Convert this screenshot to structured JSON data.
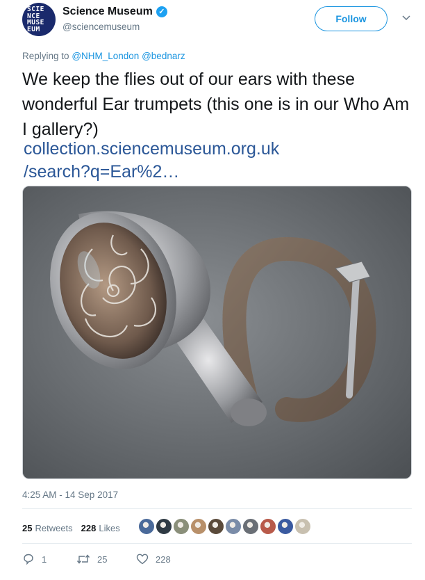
{
  "account": {
    "display_name": "Science Museum",
    "handle": "@sciencemuseum",
    "avatar_logo_lines": [
      "SCIE",
      "NCE",
      "MUSE",
      "EUM"
    ],
    "verified_icon": "verified-badge-icon",
    "verified_glyph": "✓"
  },
  "follow_button": {
    "label": "Follow"
  },
  "menu_caret": {
    "glyph": "⌄",
    "icon": "chevron-down-icon"
  },
  "reply": {
    "prefix": "Replying to",
    "mentions": [
      "@NHM_London",
      "@bednarz"
    ]
  },
  "tweet": {
    "text": "We keep the flies out of our ears with these wonderful Ear trumpets (this one is in our Who Am I gallery?)",
    "link_line1": "collection.sciencemuseum.org.uk",
    "link_line2": "/search?q=Ear%2…"
  },
  "media": {
    "subject": "ear trumpet"
  },
  "timestamp": "4:25 AM - 14 Sep 2017",
  "stats": {
    "retweets_count": "25",
    "retweets_label": "Retweets",
    "likes_count": "228",
    "likes_label": "Likes"
  },
  "likers_avatar_colors": [
    "#4a6a9a",
    "#2f3a44",
    "#8a8f7a",
    "#b8906a",
    "#5a4a3a",
    "#7a8ca8",
    "#6a6f76",
    "#b85a4a",
    "#3a5aa0",
    "#c8c0b0"
  ],
  "actions": {
    "reply_count": "1",
    "retweet_count": "25",
    "like_count": "228"
  },
  "colors": {
    "link": "#1b95e0",
    "link_url": "#2b5797",
    "verified": "#1da1f2",
    "muted": "#657786"
  }
}
